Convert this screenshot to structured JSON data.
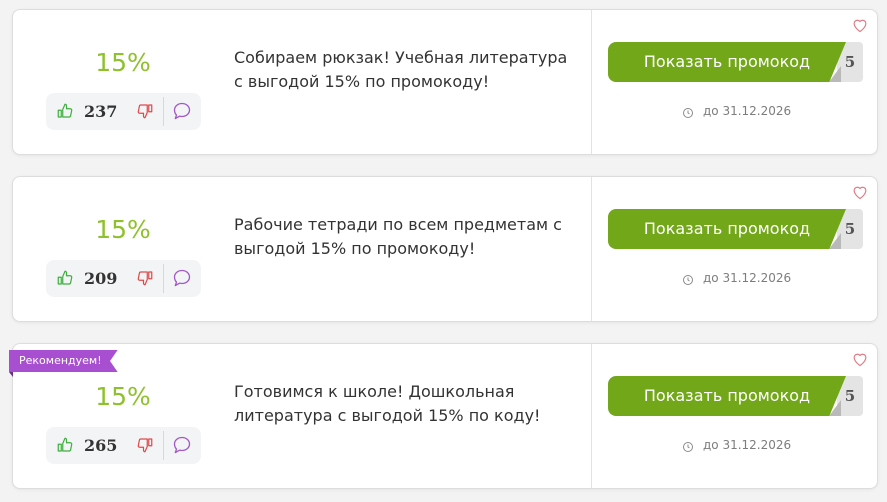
{
  "colors": {
    "discount": "#8fc12c",
    "promo_button": "#73a71a",
    "ribbon": "#a74fd0"
  },
  "coupons": [
    {
      "discount": "15%",
      "votes": "237",
      "description": "Собираем рюкзак! Учебная литература с выгодой 15% по промокоду!",
      "button_label": "Показать промокод",
      "code_hint": "5",
      "expiry": "до 31.12.2026",
      "badge": ""
    },
    {
      "discount": "15%",
      "votes": "209",
      "description": "Рабочие тетради по всем предметам с выгодой 15% по промокоду!",
      "button_label": "Показать промокод",
      "code_hint": "5",
      "expiry": "до 31.12.2026",
      "badge": ""
    },
    {
      "discount": "15%",
      "votes": "265",
      "description": "Готовимся к школе! Дошкольная литература с выгодой 15% по коду!",
      "button_label": "Показать промокод",
      "code_hint": "5",
      "expiry": "до 31.12.2026",
      "badge": "Рекомендуем!"
    }
  ],
  "icons": {
    "vote_up": "thumbs-up-icon",
    "vote_down": "thumbs-down-icon",
    "comment": "comment-icon",
    "clock": "clock-icon",
    "favorite": "heart-icon"
  }
}
